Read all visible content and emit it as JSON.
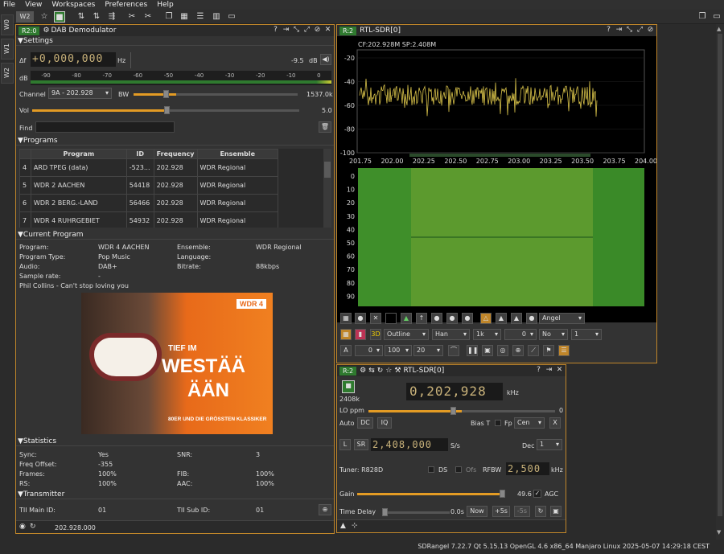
{
  "menu": [
    "File",
    "View",
    "Workspaces",
    "Preferences",
    "Help"
  ],
  "workspace_badge": "W2",
  "vtabs": [
    "W0",
    "W1",
    "W2"
  ],
  "dab": {
    "badge": "R2:0",
    "title": "DAB Demodulator",
    "settings_label": "Settings",
    "delta_f_label": "Δf",
    "delta_f_value": "+0,000,000",
    "hz_label": "Hz",
    "level_value": "-9.5",
    "db_label": "dB",
    "meter_db_label": "dB",
    "meter_ticks": [
      "-90",
      "-80",
      "-70",
      "-60",
      "-50",
      "-40",
      "-30",
      "-20",
      "-10",
      "0"
    ],
    "channel_label": "Channel",
    "channel_value": "9A - 202.928",
    "bw_label": "BW",
    "bw_value": "1537.0k",
    "bw_level": 0.26,
    "vol_label": "Vol",
    "vol_value": "5.0",
    "vol_level": 0.5,
    "find_label": "Find",
    "programs_label": "Programs",
    "columns": [
      "Program",
      "ID",
      "Frequency",
      "Ensemble"
    ],
    "rows": [
      {
        "n": "4",
        "program": "ARD TPEG          (data)",
        "id": "-523...",
        "freq": "202.928",
        "ens": "WDR Regional"
      },
      {
        "n": "5",
        "program": "WDR 2 AACHEN",
        "id": "54418",
        "freq": "202.928",
        "ens": "WDR Regional"
      },
      {
        "n": "6",
        "program": "WDR 2 BERG.-LAND",
        "id": "56466",
        "freq": "202.928",
        "ens": "WDR Regional"
      },
      {
        "n": "7",
        "program": "WDR 4 RUHRGEBIET",
        "id": "54932",
        "freq": "202.928",
        "ens": "WDR Regional"
      }
    ],
    "current_program_label": "Current Program",
    "program_label": "Program:",
    "program_value": "WDR 4 AACHEN",
    "ensemble_label": "Ensemble:",
    "ensemble_value": "WDR Regional",
    "program_type_label": "Program Type:",
    "program_type_value": "Pop Music",
    "language_label": "Language:",
    "audio_label": "Audio:",
    "audio_value": "DAB+",
    "bitrate_label": "Bitrate:",
    "bitrate_value": "88kbps",
    "sample_rate_label": "Sample rate:",
    "sample_rate_value": "-",
    "now_playing": "Phil Collins - Can't stop loving you",
    "slide_logo": "WDR 4",
    "slide_line1": "TIEF IM",
    "slide_line2": "WESTÄÄ",
    "slide_line3": "ÄÄN",
    "slide_line4": "80ER UND DIE GRÖSSTEN KLASSIKER",
    "statistics_label": "Statistics",
    "sync_label": "Sync:",
    "sync_value": "Yes",
    "snr_label": "SNR:",
    "snr_value": "3",
    "freq_offset_label": "Freq Offset:",
    "freq_offset_value": "-355",
    "frames_label": "Frames:",
    "frames_value": "100%",
    "fib_label": "FIB:",
    "fib_value": "100%",
    "rs_label": "RS:",
    "rs_value": "100%",
    "aac_label": "AAC:",
    "aac_value": "100%",
    "transmitter_label": "Transmitter",
    "tii_main_label": "TII Main ID:",
    "tii_main_value": "01",
    "tii_sub_label": "TII Sub ID:",
    "tii_sub_value": "01",
    "footer_freq": "202.928.000"
  },
  "spectrum": {
    "badge": "R:2",
    "title": "RTL-SDR[0]",
    "info": "CF:202.928M SP:2.408M",
    "y_ticks": [
      "-20",
      "-40",
      "-60",
      "-80",
      "-100"
    ],
    "x_ticks": [
      "201.75",
      "202.00",
      "202.25",
      "202.50",
      "202.75",
      "203.00",
      "203.25",
      "203.50",
      "203.75",
      "204.00"
    ],
    "wf_ticks": [
      "0",
      "10",
      "20",
      "30",
      "40",
      "50",
      "60",
      "70",
      "80",
      "90"
    ],
    "palette": "Angel",
    "style": "Outline",
    "window": "Han",
    "fft": "1k",
    "overlap": "0",
    "avg_mode": "No",
    "avg": "1",
    "a_label": "A",
    "ref_level": "0",
    "range": "100",
    "fps": "20"
  },
  "device": {
    "badge": "R:2",
    "title": "RTL-SDR[0]",
    "sample_rate_small": "2408k",
    "freq": "0,202,928",
    "khz": "kHz",
    "lo_ppm_label": "LO ppm",
    "lo_ppm_value": "0",
    "lo_ppm_level": 0.5,
    "auto_label": "Auto",
    "dc_label": "DC",
    "iq_label": "IQ",
    "bias_t_label": "Bias T",
    "fp_label": "Fp",
    "cen_value": "Cen",
    "x_label": "X",
    "l_label": "L",
    "sr_label": "SR",
    "sr_value": "2,408,000",
    "sps": "S/s",
    "dec_label": "Dec",
    "dec_value": "1",
    "tuner_label": "Tuner: R828D",
    "ds_label": "DS",
    "ofs_label": "Ofs",
    "rfbw_label": "RFBW",
    "rfbw_value": "2,500",
    "rfbw_unit": "kHz",
    "gain_label": "Gain",
    "gain_value": "49.6",
    "gain_level": 0.99,
    "agc_label": "AGC",
    "time_delay_label": "Time Delay",
    "time_delay_value": "0.0s",
    "now_label": "Now",
    "plus5_label": "+5s",
    "minus5_label": "-5s"
  },
  "status": "SDRangel 7.22.7 Qt 5.15.13 OpenGL 4.6 x86_64 Manjaro Linux  2025-05-07 14:29:18 CEST",
  "colors": {
    "accent": "#e39b24",
    "badge": "#2f7a2f",
    "trace": "#d8c24a"
  }
}
